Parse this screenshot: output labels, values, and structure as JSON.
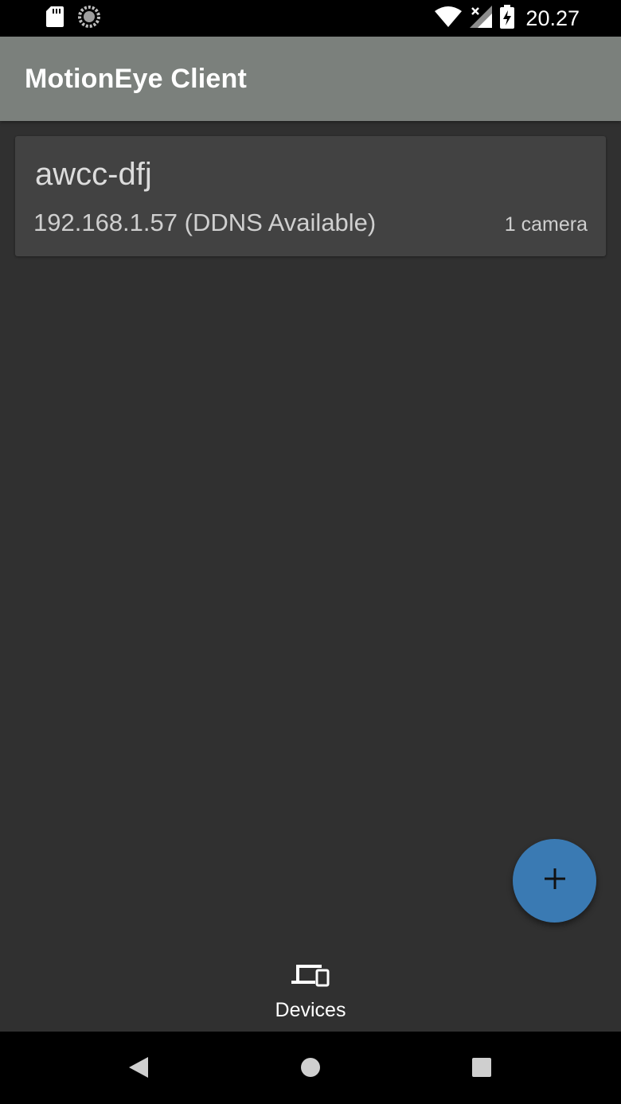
{
  "status_bar": {
    "time": "20.27",
    "icons": [
      "sd-card-icon",
      "sync-icon",
      "wifi-icon",
      "signal-icon",
      "battery-charging-icon"
    ]
  },
  "app_bar": {
    "title": "MotionEye Client"
  },
  "devices": [
    {
      "name": "awcc-dfj",
      "address": "192.168.1.57 (DDNS Available)",
      "cameras": "1 camera"
    }
  ],
  "fab": {
    "icon": "plus-icon"
  },
  "bottom_nav": {
    "items": [
      {
        "label": "Devices",
        "icon": "devices-icon"
      }
    ]
  },
  "system_nav": {
    "icons": [
      "back-icon",
      "home-icon",
      "recents-icon"
    ]
  },
  "colors": {
    "background": "#303030",
    "app_bar": "#7b807c",
    "card": "#424242",
    "fab": "#3a7ab3",
    "status_bar": "#000000"
  }
}
